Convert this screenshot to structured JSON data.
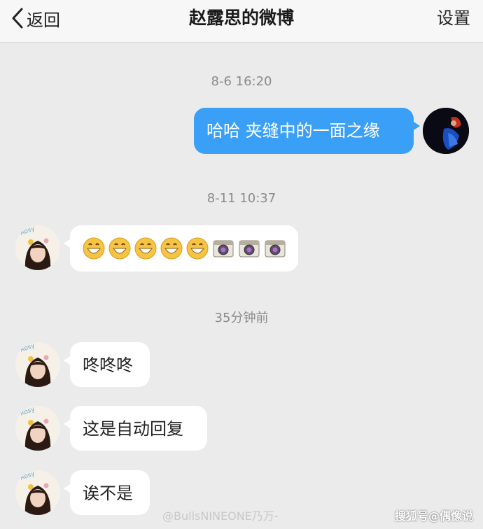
{
  "nav": {
    "back_label": "返回",
    "title": "赵露思的微博",
    "settings_label": "设置"
  },
  "messages": [
    {
      "time": "8-6 16:20",
      "from": "self",
      "text": "哈哈 夹缝中的一面之缘"
    },
    {
      "time": "8-11 10:37",
      "from": "other",
      "emojis": [
        "grin-emoji",
        "grin-emoji",
        "grin-emoji",
        "grin-emoji",
        "grin-emoji",
        "camera-emoji",
        "camera-emoji",
        "camera-emoji"
      ]
    },
    {
      "time": "35分钟前",
      "from": "other",
      "text": "咚咚咚"
    },
    {
      "from": "other",
      "text": "这是自动回复"
    },
    {
      "from": "other",
      "text": "诶不是"
    }
  ],
  "avatar_label": "Rosy",
  "watermarks": {
    "left": "@BullsNINEONE乃万-",
    "right": "搜狐号@偶像说"
  },
  "colors": {
    "nav_bg": "#f7f7f7",
    "page_bg": "#ebebeb",
    "self_bubble": "#3aa0f7",
    "other_bubble": "#ffffff",
    "timestamp": "#8a8a8a"
  }
}
